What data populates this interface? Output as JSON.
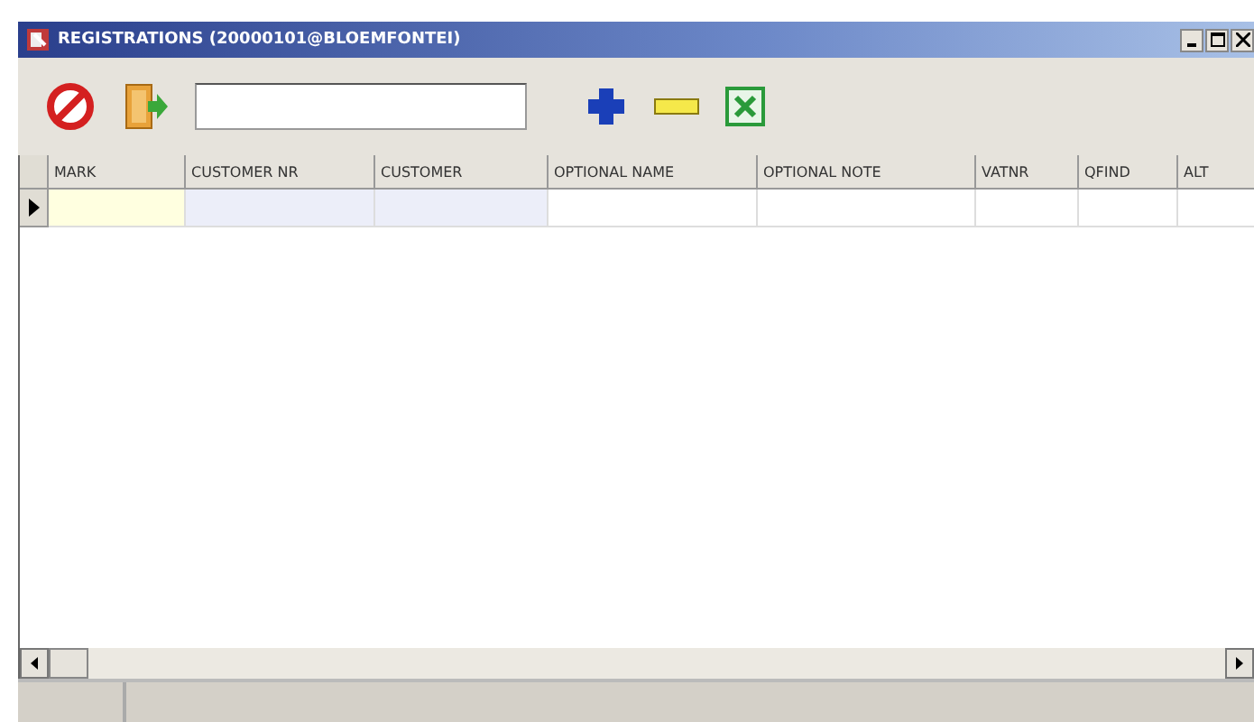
{
  "window": {
    "title": "REGISTRATIONS (20000101@BLOEMFONTEI)"
  },
  "table": {
    "columns": [
      {
        "label": "MARK",
        "color": "#ffffe0"
      },
      {
        "label": "CUSTOMER NR",
        "color": "#eceef9"
      },
      {
        "label": "CUSTOMER",
        "color": "#eceef9"
      },
      {
        "label": "OPTIONAL NAME",
        "color": "#ffffff"
      },
      {
        "label": "OPTIONAL NOTE",
        "color": "#ffffff"
      },
      {
        "label": "VATNR",
        "color": "#ffffff"
      },
      {
        "label": "QFIND",
        "color": "#ffffff"
      },
      {
        "label": "ALT",
        "color": "#ffffff"
      }
    ],
    "rows": [
      {
        "selected": true
      }
    ]
  }
}
